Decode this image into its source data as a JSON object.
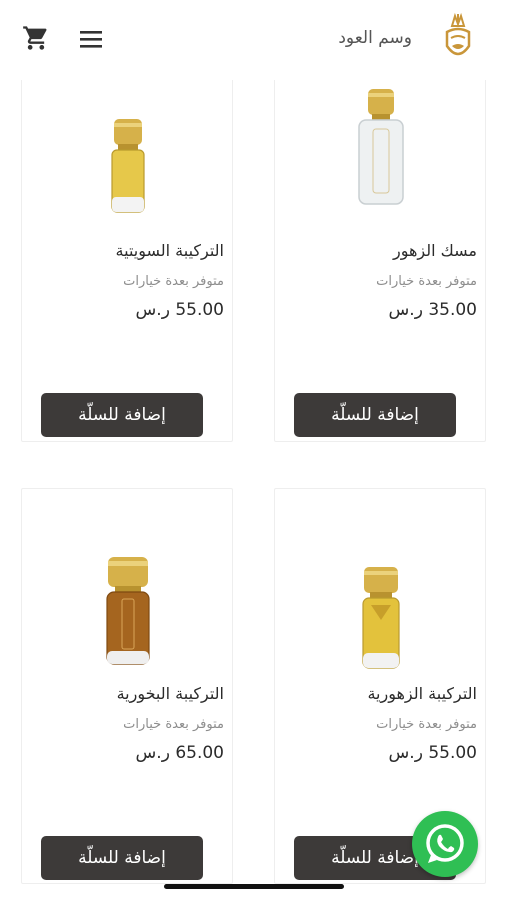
{
  "header": {
    "brand_name": "وسم العود",
    "logo_icon": "crowned-face-logo",
    "menu_icon": "hamburger-menu-icon",
    "cart_icon": "shopping-cart-icon"
  },
  "products": [
    {
      "title": "مسك الزهور",
      "availability": "متوفر بعدة خيارات",
      "price": "35.00 ر.س",
      "button": "إضافة للسلّة",
      "image": "clear-perfume-bottle"
    },
    {
      "title": "التركيبة السويتية",
      "availability": "متوفر بعدة خيارات",
      "price": "55.00 ر.س",
      "button": "إضافة للسلّة",
      "image": "golden-perfume-bottle"
    },
    {
      "title": "التركيبة الزهورية",
      "availability": "متوفر بعدة خيارات",
      "price": "55.00 ر.س",
      "button": "إضافة للسلّة",
      "image": "golden-perfume-bottle"
    },
    {
      "title": "التركيبة البخورية",
      "availability": "متوفر بعدة خيارات",
      "price": "65.00 ر.س",
      "button": "إضافة للسلّة",
      "image": "amber-perfume-bottle"
    }
  ],
  "floating": {
    "whatsapp_icon": "whatsapp-icon"
  },
  "colors": {
    "button_bg": "#3d3a39",
    "whatsapp_green": "#2fbf54",
    "logo_gold": "#c9963a"
  }
}
